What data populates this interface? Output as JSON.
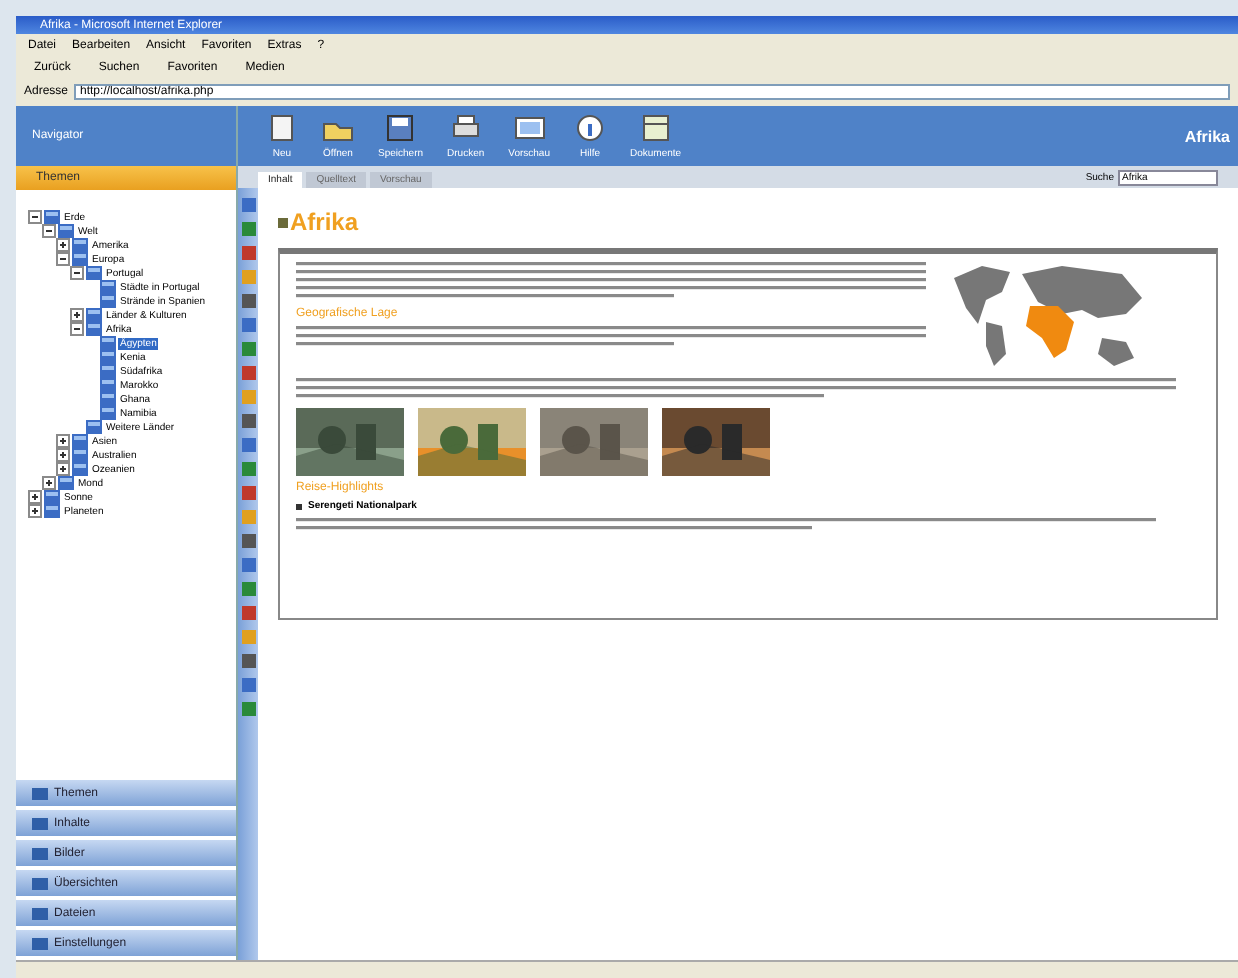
{
  "window": {
    "title": "Afrika - Microsoft Internet Explorer"
  },
  "menu": [
    "Datei",
    "Bearbeiten",
    "Ansicht",
    "Favoriten",
    "Extras",
    "?"
  ],
  "browser_toolbar": [
    "Zurück",
    "Suchen",
    "Favoriten",
    "Medien"
  ],
  "address": {
    "label": "Adresse",
    "value": "http://localhost/afrika.php"
  },
  "sidebar": {
    "title": "Navigator",
    "section": "Themen",
    "tree": [
      {
        "label": "Erde",
        "expanded": true,
        "children": [
          {
            "label": "Welt",
            "expanded": true,
            "children": [
              {
                "label": "Amerika",
                "expanded": false
              },
              {
                "label": "Europa",
                "expanded": true,
                "children": [
                  {
                    "label": "Portugal",
                    "expanded": true,
                    "children": [
                      {
                        "label": "Städte in Portugal"
                      },
                      {
                        "label": "Strände in Spanien"
                      }
                    ]
                  },
                  {
                    "label": "Länder & Kulturen",
                    "expanded": false
                  },
                  {
                    "label": "Afrika",
                    "expanded": true,
                    "children": [
                      {
                        "label": "Ägypten",
                        "selected": true
                      },
                      {
                        "label": "Kenia",
                        "selected": false
                      },
                      {
                        "label": "Südafrika",
                        "selected": false
                      },
                      {
                        "label": "Marokko",
                        "selected": false
                      },
                      {
                        "label": "Ghana",
                        "selected": false
                      },
                      {
                        "label": "Namibia",
                        "selected": false
                      }
                    ]
                  },
                  {
                    "label": "Weitere Länder"
                  }
                ]
              },
              {
                "label": "Asien",
                "expanded": false
              },
              {
                "label": "Australien",
                "expanded": false
              },
              {
                "label": "Ozeanien",
                "expanded": false
              }
            ]
          },
          {
            "label": "Mond",
            "expanded": false
          }
        ]
      },
      {
        "label": "Sonne",
        "expanded": false
      },
      {
        "label": "Planeten",
        "expanded": false
      }
    ],
    "panels": [
      "Themen",
      "Inhalte",
      "Bilder",
      "Übersichten",
      "Dateien",
      "Einstellungen"
    ]
  },
  "app_toolbar": [
    "Neu",
    "Öffnen",
    "Speichern",
    "Drucken",
    "Vorschau",
    "Hilfe",
    "Dokumente"
  ],
  "header_title": "Afrika",
  "tabs": [
    {
      "label": "Inhalt",
      "selected": true
    },
    {
      "label": "Quelltext",
      "selected": false
    },
    {
      "label": "Vorschau",
      "selected": false
    }
  ],
  "search": {
    "label": "Suche",
    "value": "Afrika"
  },
  "page": {
    "title": "Afrika",
    "headings": [
      "Geografische Lage",
      "Reise-Highlights"
    ],
    "bullet": "Serengeti Nationalpark"
  }
}
